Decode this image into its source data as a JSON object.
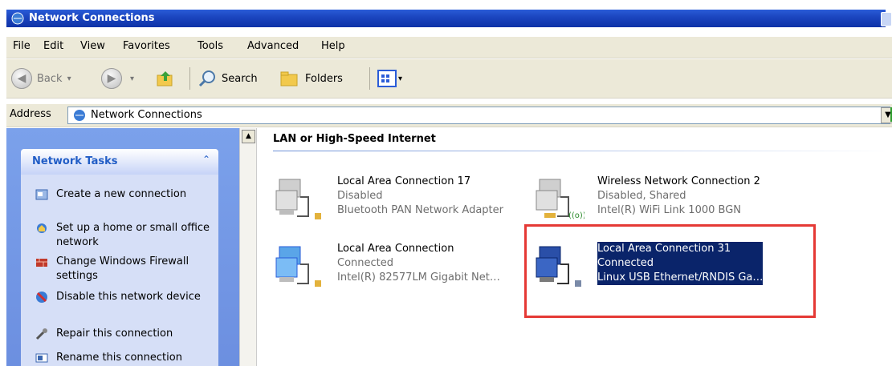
{
  "window": {
    "title": "Network Connections"
  },
  "menu": [
    "File",
    "Edit",
    "View",
    "Favorites",
    "Tools",
    "Advanced",
    "Help"
  ],
  "toolbar": {
    "back": "Back",
    "search": "Search",
    "folders": "Folders"
  },
  "address": {
    "label": "Address",
    "value": "Network Connections"
  },
  "tasks": {
    "title": "Network Tasks",
    "items": [
      {
        "label": "Create a new connection",
        "icon": "new-connection-icon"
      },
      {
        "label": "Set up a home or small office network",
        "icon": "home-network-icon"
      },
      {
        "label": "Change Windows Firewall settings",
        "icon": "firewall-icon"
      },
      {
        "label": "Disable this network device",
        "icon": "disable-icon"
      },
      {
        "label": "Repair this connection",
        "icon": "repair-icon"
      },
      {
        "label": "Rename this connection",
        "icon": "rename-icon"
      }
    ]
  },
  "section": {
    "title": "LAN or High-Speed Internet"
  },
  "connections": [
    {
      "name": "Local Area Connection 17",
      "status": "Disabled",
      "device": "Bluetooth PAN Network Adapter"
    },
    {
      "name": "Wireless Network Connection 2",
      "status": "Disabled, Shared",
      "device": "Intel(R) WiFi Link 1000 BGN"
    },
    {
      "name": "Local Area Connection",
      "status": "Connected",
      "device": "Intel(R) 82577LM Gigabit Net…"
    },
    {
      "name": "Local Area Connection 31",
      "status": "Connected",
      "device": "Linux USB Ethernet/RNDIS Ga…"
    }
  ]
}
